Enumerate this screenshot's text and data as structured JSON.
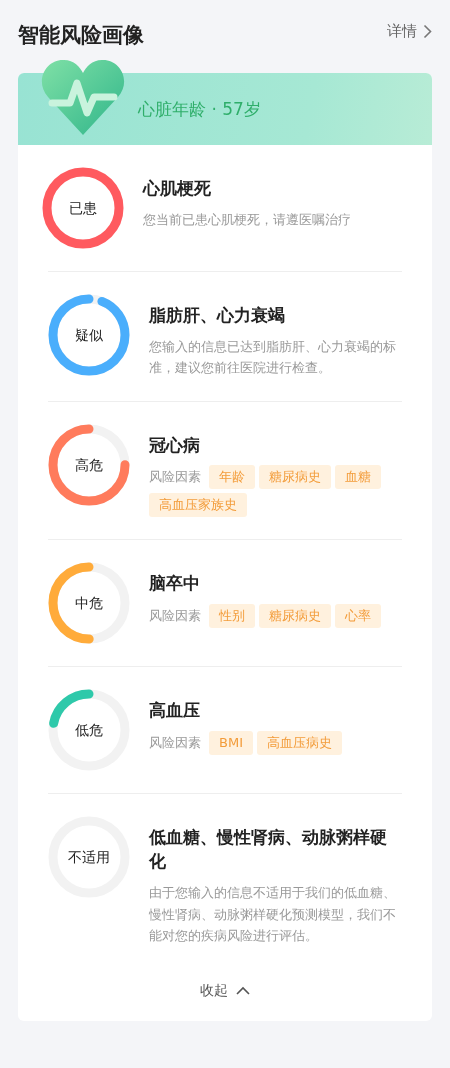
{
  "header": {
    "title": "智能风险画像",
    "link": "详情"
  },
  "banner": {
    "text": "心脏年龄 · 57岁"
  },
  "items": [
    {
      "status": "已患",
      "kind": "diagnosed",
      "color": "#ff5a5f",
      "title": "心肌梗死",
      "description": "您当前已患心肌梗死，请遵医嘱治疗"
    },
    {
      "status": "疑似",
      "kind": "suspected",
      "color": "#4aaefc",
      "title": "脂肪肝、心力衰竭",
      "description": "您输入的信息已达到脂肪肝、心力衰竭的标准，建议您前往医院进行检查。"
    },
    {
      "status": "高危",
      "kind": "high",
      "color": "#ff7b5c",
      "title": "冠心病",
      "factors_label": "风险因素",
      "factors": [
        "年龄",
        "糖尿病史",
        "血糖",
        "高血压家族史"
      ]
    },
    {
      "status": "中危",
      "kind": "medium",
      "color": "#ffab3a",
      "title": "脑卒中",
      "factors_label": "风险因素",
      "factors": [
        "性别",
        "糖尿病史",
        "心率"
      ]
    },
    {
      "status": "低危",
      "kind": "low",
      "color": "#2ec9aa",
      "title": "高血压",
      "factors_label": "风险因素",
      "factors": [
        "BMI",
        "高血压病史"
      ]
    },
    {
      "status": "不适用",
      "kind": "not_applicable",
      "color": "#f2f2f2",
      "title": "低血糖、慢性肾病、动脉粥样硬化",
      "description": "由于您输入的信息不适用于我们的低血糖、慢性肾病、动脉粥样硬化预测模型，我们不能对您的疾病风险进行评估。"
    }
  ],
  "collapse": {
    "label": "收起"
  }
}
